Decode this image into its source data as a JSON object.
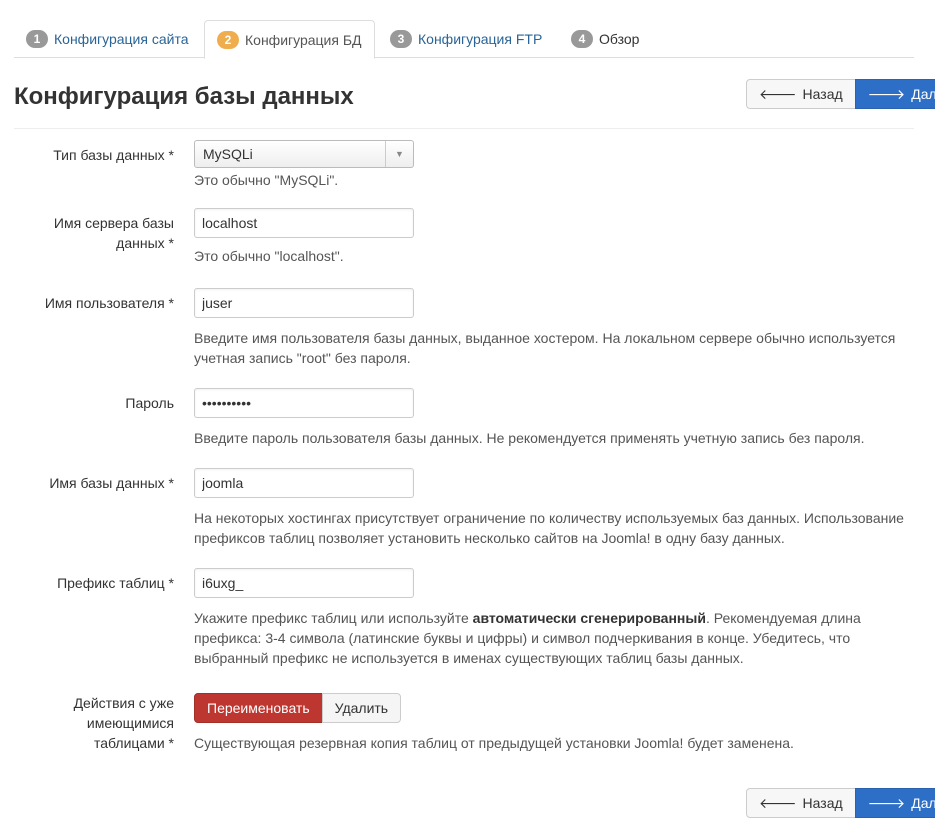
{
  "tabs": [
    {
      "num": "1",
      "label": "Конфигурация сайта"
    },
    {
      "num": "2",
      "label": "Конфигурация БД"
    },
    {
      "num": "3",
      "label": "Конфигурация FTP"
    },
    {
      "num": "4",
      "label": "Обзор"
    }
  ],
  "header": {
    "title": "Конфигурация базы данных",
    "back_label": "Назад",
    "next_label": "Далее"
  },
  "form": {
    "db_type": {
      "label": "Тип базы данных *",
      "value": "MySQLi",
      "help": "Это обычно \"MySQLi\"."
    },
    "host": {
      "label": "Имя сервера базы данных *",
      "value": "localhost",
      "help": "Это обычно \"localhost\"."
    },
    "user": {
      "label": "Имя пользователя *",
      "value": "juser",
      "help": "Введите имя пользователя базы данных, выданное хостером. На локальном сервере обычно используется учетная запись \"root\" без пароля."
    },
    "password": {
      "label": "Пароль",
      "value": "••••••••••",
      "help": "Введите пароль пользователя базы данных. Не рекомендуется применять учетную запись без пароля."
    },
    "db_name": {
      "label": "Имя базы данных *",
      "value": "joomla",
      "help": "На некоторых хостингах присутствует ограничение по количеству используемых баз данных. Использование префиксов таблиц позволяет установить несколько сайтов на Joomla! в одну базу данных."
    },
    "prefix": {
      "label": "Префикс таблиц *",
      "value": "i6uxg_",
      "help_before": "Укажите префикс таблиц или используйте ",
      "help_bold": "автоматически сгенерированный",
      "help_after": ". Рекомендуемая длина префикса: 3-4 символа (латинские буквы и цифры) и символ подчеркивания в конце. Убедитесь, что выбранный префикс не используется в именах существующих таблиц базы данных."
    },
    "old_tables": {
      "label": "Действия с уже имеющимися таблицами *",
      "rename_label": "Переименовать",
      "delete_label": "Удалить",
      "help": "Существующая резервная копия таблиц от предыдущей установки Joomla! будет заменена."
    }
  },
  "footer": {
    "back_label": "Назад",
    "next_label": "Далее"
  },
  "colors": {
    "primary": "#2d6ec7",
    "danger": "#bd362f",
    "active_badge": "#f0ad4e"
  }
}
